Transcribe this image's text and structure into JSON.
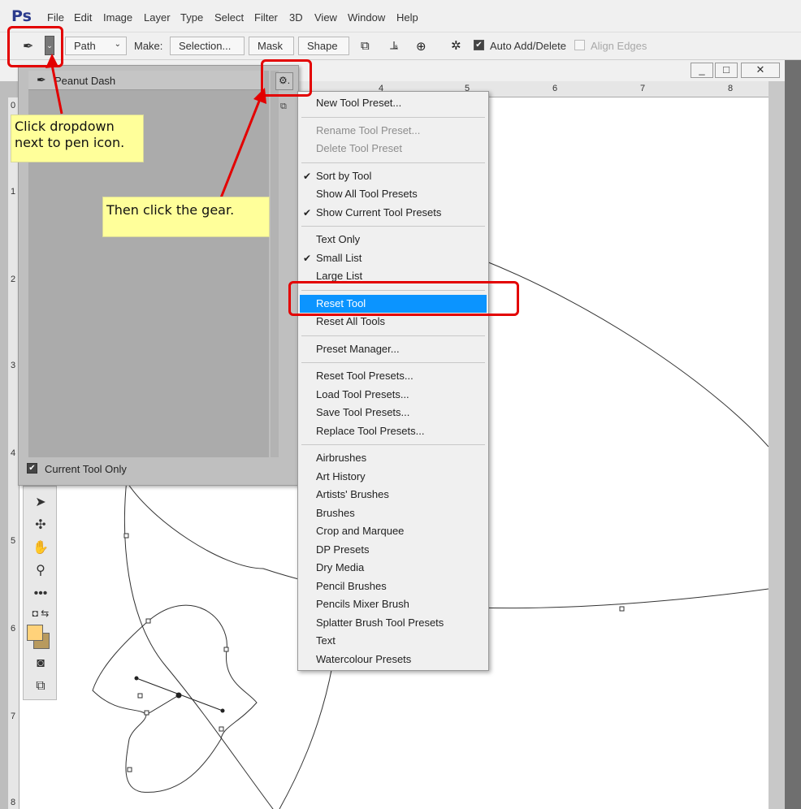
{
  "app": {
    "logo": "Ps",
    "menu": [
      "File",
      "Edit",
      "Image",
      "Layer",
      "Type",
      "Select",
      "Filter",
      "3D",
      "View",
      "Window",
      "Help"
    ]
  },
  "options_bar": {
    "mode": "Path",
    "make_label": "Make:",
    "selection_btn": "Selection...",
    "mask_btn": "Mask",
    "shape_btn": "Shape",
    "auto_add_delete": "Auto Add/Delete",
    "auto_add_delete_checked": true,
    "align_edges": "Align Edges",
    "align_edges_checked": false
  },
  "window_controls": [
    "_",
    "□",
    "✕"
  ],
  "ruler": {
    "top": [
      "4",
      "5",
      "6",
      "7",
      "8"
    ],
    "left": [
      "0",
      "1",
      "2",
      "3",
      "4",
      "5",
      "6",
      "7",
      "8"
    ]
  },
  "preset_panel": {
    "item": "Peanut Dash",
    "gear": "⚙.",
    "current_tool_only": "Current Tool Only"
  },
  "context_menu": {
    "items": [
      {
        "label": "New Tool Preset...",
        "enabled": true,
        "checked": false
      },
      {
        "sep": true
      },
      {
        "label": "Rename Tool Preset...",
        "enabled": false,
        "checked": false
      },
      {
        "label": "Delete Tool Preset",
        "enabled": false,
        "checked": false
      },
      {
        "sep": true
      },
      {
        "label": "Sort by Tool",
        "enabled": true,
        "checked": true
      },
      {
        "label": "Show All Tool Presets",
        "enabled": true,
        "checked": false
      },
      {
        "label": "Show Current Tool Presets",
        "enabled": true,
        "checked": true
      },
      {
        "sep": true
      },
      {
        "label": "Text Only",
        "enabled": true,
        "checked": false
      },
      {
        "label": "Small List",
        "enabled": true,
        "checked": true
      },
      {
        "label": "Large List",
        "enabled": true,
        "checked": false
      },
      {
        "sep": true
      },
      {
        "label": "Reset Tool",
        "enabled": true,
        "checked": false,
        "highlighted": true
      },
      {
        "label": "Reset All Tools",
        "enabled": true,
        "checked": false
      },
      {
        "sep": true
      },
      {
        "label": "Preset Manager...",
        "enabled": true,
        "checked": false
      },
      {
        "sep": true
      },
      {
        "label": "Reset Tool Presets...",
        "enabled": true,
        "checked": false
      },
      {
        "label": "Load Tool Presets...",
        "enabled": true,
        "checked": false
      },
      {
        "label": "Save Tool Presets...",
        "enabled": true,
        "checked": false
      },
      {
        "label": "Replace Tool Presets...",
        "enabled": true,
        "checked": false
      },
      {
        "sep": true
      },
      {
        "label": "Airbrushes",
        "enabled": true,
        "checked": false
      },
      {
        "label": "Art History",
        "enabled": true,
        "checked": false
      },
      {
        "label": "Artists' Brushes",
        "enabled": true,
        "checked": false
      },
      {
        "label": "Brushes",
        "enabled": true,
        "checked": false
      },
      {
        "label": "Crop and Marquee",
        "enabled": true,
        "checked": false
      },
      {
        "label": "DP Presets",
        "enabled": true,
        "checked": false
      },
      {
        "label": "Dry Media",
        "enabled": true,
        "checked": false
      },
      {
        "label": "Pencil Brushes",
        "enabled": true,
        "checked": false
      },
      {
        "label": "Pencils Mixer Brush",
        "enabled": true,
        "checked": false
      },
      {
        "label": "Splatter Brush Tool Presets",
        "enabled": true,
        "checked": false
      },
      {
        "label": "Text",
        "enabled": true,
        "checked": false
      },
      {
        "label": "Watercolour Presets",
        "enabled": true,
        "checked": false
      }
    ]
  },
  "annotations": {
    "callout1": "Click dropdown next to pen icon.",
    "callout2": "Then click the gear."
  },
  "colors": {
    "highlight": "#0b94ff",
    "annotation_red": "#e30000",
    "callout_bg": "#ffff9a",
    "foreground_swatch": "#ffd27a",
    "background_swatch": "#b89a5e"
  }
}
